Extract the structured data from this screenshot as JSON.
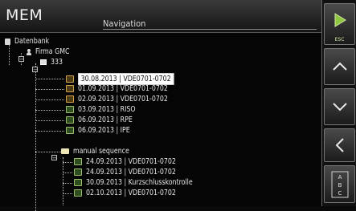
{
  "header": {
    "app_name": "MEM",
    "title": "Navigation"
  },
  "tree": [
    {
      "label": "Datenbank",
      "icon": "database-icon"
    },
    {
      "label": "Firma GMC",
      "icon": "customer-icon"
    },
    {
      "label": "333",
      "icon": "device-icon"
    },
    {
      "label": "30.08.2013 | VDE0701-0702",
      "icon": "test-warning-icon",
      "selected": true
    },
    {
      "label": "01.09.2013 | VDE0701-0702",
      "icon": "test-warning-icon"
    },
    {
      "label": "02.09.2013 | VDE0701-0702",
      "icon": "test-warning-icon"
    },
    {
      "label": "03.09.2013 | RISO",
      "icon": "test-pass-icon"
    },
    {
      "label": "06.09.2013 | RPE",
      "icon": "test-pass-icon"
    },
    {
      "label": "06.09.2013 | IPE",
      "icon": "test-pass-icon"
    },
    {
      "label": "manual sequence",
      "icon": "folder-icon"
    },
    {
      "label": "24.09.2013 | VDE0701-0702",
      "icon": "test-pass-icon"
    },
    {
      "label": "24.09.2013 | VDE0701-0702",
      "icon": "test-pass-icon"
    },
    {
      "label": "30.09.2013 | Kurzschlusskontrolle",
      "icon": "test-pass-icon"
    },
    {
      "label": "02.10.2013 | VDE0701-0702",
      "icon": "test-pass-icon"
    }
  ],
  "sidebar": {
    "start_label": "ESC",
    "buttons": [
      "start-icon",
      "up-icon",
      "down-icon",
      "back-icon",
      "abc-keyboard-icon"
    ],
    "accent_color": "#8fc63f"
  }
}
